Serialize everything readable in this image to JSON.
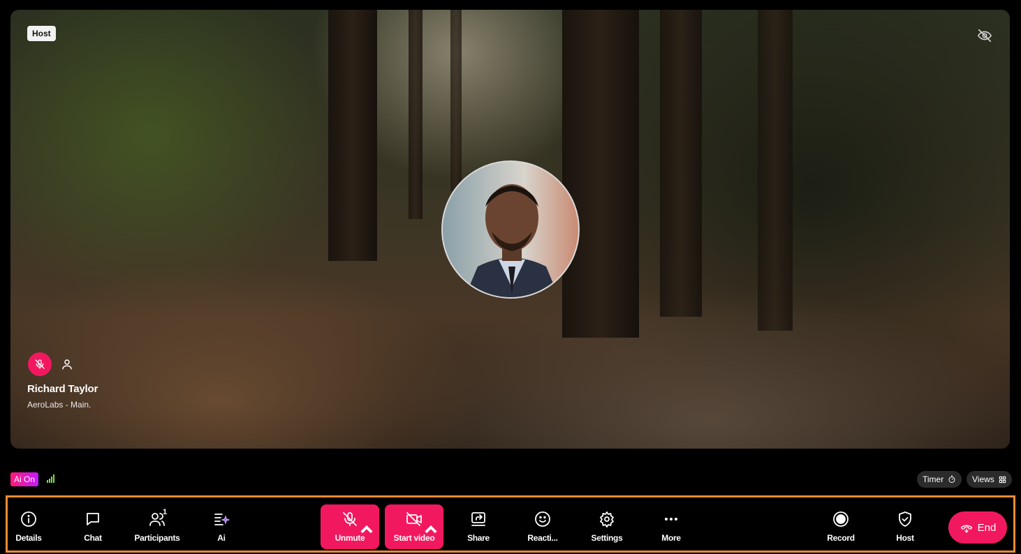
{
  "stage": {
    "host_tag": "Host",
    "participant": {
      "name": "Richard Taylor",
      "subtitle": "AeroLabs - Main."
    }
  },
  "status": {
    "ai_badge": "Ai On",
    "timer_label": "Timer",
    "views_label": "Views"
  },
  "toolbar": {
    "details": "Details",
    "chat": "Chat",
    "participants": "Participants",
    "participants_count": "1",
    "ai": "Ai",
    "unmute": "Unmute",
    "start_video": "Start video",
    "share": "Share",
    "reactions": "Reacti...",
    "settings": "Settings",
    "more": "More",
    "record": "Record",
    "host": "Host",
    "end": "End"
  },
  "colors": {
    "accent": "#f2185f",
    "highlight_border": "#f28a33",
    "pill_bg": "#2b2b2b"
  }
}
